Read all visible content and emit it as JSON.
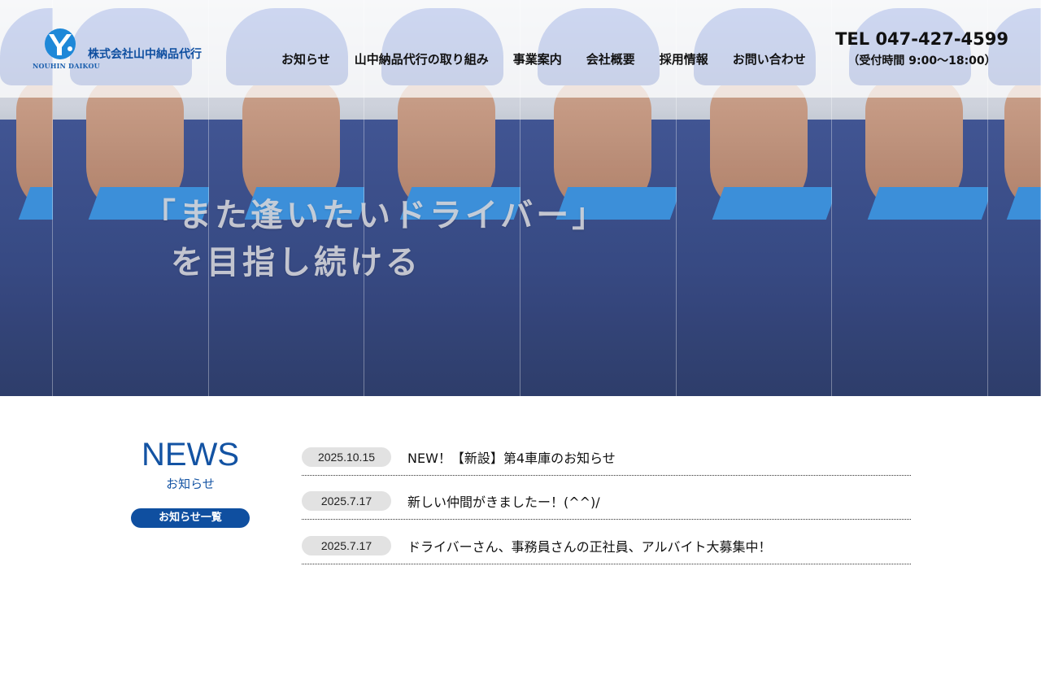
{
  "header": {
    "logo_sub": "NOUHIN DAIKOU",
    "company_name": "株式会社山中納品代行",
    "nav": [
      {
        "label": "お知らせ"
      },
      {
        "label": "山中納品代行の取り組み"
      },
      {
        "label": "事業案内"
      },
      {
        "label": "会社概要"
      },
      {
        "label": "採用情報"
      },
      {
        "label": "お問い合わせ"
      }
    ],
    "tel": "TEL 047-427-4599",
    "hours": "（受付時間 9:00〜18:00）"
  },
  "hero": {
    "line1": "「また逢いたいドライバー」",
    "line2": "を目指し続ける"
  },
  "news": {
    "title": "NEWS",
    "subtitle": "お知らせ",
    "button_label": "お知らせ一覧",
    "items": [
      {
        "date": "2025.10.15",
        "text": "NEW！【新設】第4車庫のお知らせ"
      },
      {
        "date": "2025.7.17",
        "text": "新しい仲間がきましたー！(^^)/"
      },
      {
        "date": "2025.7.17",
        "text": "ドライバーさん、事務員さんの正社員、アルバイト大募集中！"
      }
    ]
  },
  "colors": {
    "brand_blue": "#0f4fa0",
    "date_pill": "#e2e2e2"
  }
}
